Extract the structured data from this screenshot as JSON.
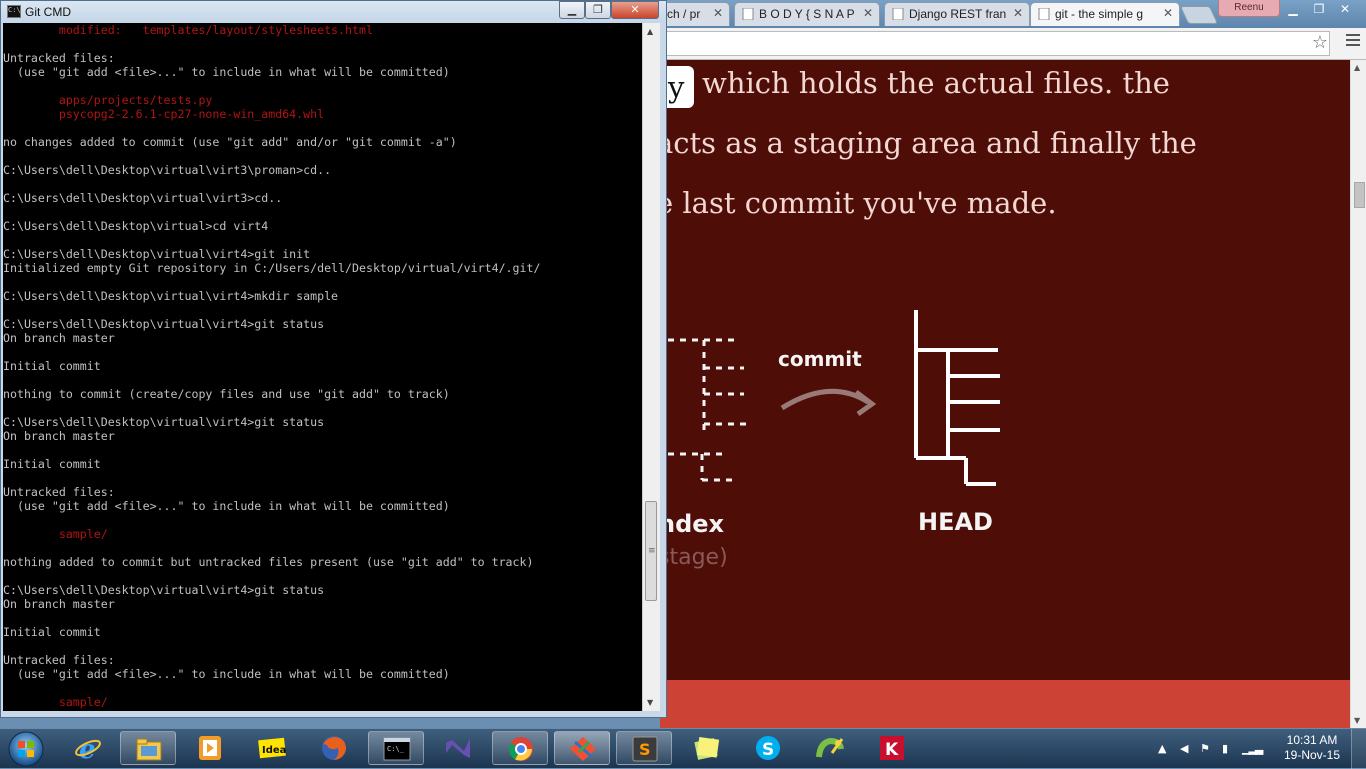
{
  "cmd": {
    "title": "Git CMD",
    "lines": [
      {
        "text": "        modified:   templates/layout/stylesheets.html",
        "color": "red"
      },
      {
        "text": "",
        "color": "gray"
      },
      {
        "text": "Untracked files:",
        "color": "gray"
      },
      {
        "text": "  (use \"git add <file>...\" to include in what will be committed)",
        "color": "gray"
      },
      {
        "text": "",
        "color": "gray"
      },
      {
        "text": "        apps/projects/tests.py",
        "color": "red"
      },
      {
        "text": "        psycopg2-2.6.1-cp27-none-win_amd64.whl",
        "color": "red"
      },
      {
        "text": "",
        "color": "gray"
      },
      {
        "text": "no changes added to commit (use \"git add\" and/or \"git commit -a\")",
        "color": "gray"
      },
      {
        "text": "",
        "color": "gray"
      },
      {
        "text": "C:\\Users\\dell\\Desktop\\virtual\\virt3\\proman>cd..",
        "color": "gray"
      },
      {
        "text": "",
        "color": "gray"
      },
      {
        "text": "C:\\Users\\dell\\Desktop\\virtual\\virt3>cd..",
        "color": "gray"
      },
      {
        "text": "",
        "color": "gray"
      },
      {
        "text": "C:\\Users\\dell\\Desktop\\virtual>cd virt4",
        "color": "gray"
      },
      {
        "text": "",
        "color": "gray"
      },
      {
        "text": "C:\\Users\\dell\\Desktop\\virtual\\virt4>git init",
        "color": "gray"
      },
      {
        "text": "Initialized empty Git repository in C:/Users/dell/Desktop/virtual/virt4/.git/",
        "color": "gray"
      },
      {
        "text": "",
        "color": "gray"
      },
      {
        "text": "C:\\Users\\dell\\Desktop\\virtual\\virt4>mkdir sample",
        "color": "gray"
      },
      {
        "text": "",
        "color": "gray"
      },
      {
        "text": "C:\\Users\\dell\\Desktop\\virtual\\virt4>git status",
        "color": "gray"
      },
      {
        "text": "On branch master",
        "color": "gray"
      },
      {
        "text": "",
        "color": "gray"
      },
      {
        "text": "Initial commit",
        "color": "gray"
      },
      {
        "text": "",
        "color": "gray"
      },
      {
        "text": "nothing to commit (create/copy files and use \"git add\" to track)",
        "color": "gray"
      },
      {
        "text": "",
        "color": "gray"
      },
      {
        "text": "C:\\Users\\dell\\Desktop\\virtual\\virt4>git status",
        "color": "gray"
      },
      {
        "text": "On branch master",
        "color": "gray"
      },
      {
        "text": "",
        "color": "gray"
      },
      {
        "text": "Initial commit",
        "color": "gray"
      },
      {
        "text": "",
        "color": "gray"
      },
      {
        "text": "Untracked files:",
        "color": "gray"
      },
      {
        "text": "  (use \"git add <file>...\" to include in what will be committed)",
        "color": "gray"
      },
      {
        "text": "",
        "color": "gray"
      },
      {
        "text": "        sample/",
        "color": "red"
      },
      {
        "text": "",
        "color": "gray"
      },
      {
        "text": "nothing added to commit but untracked files present (use \"git add\" to track)",
        "color": "gray"
      },
      {
        "text": "",
        "color": "gray"
      },
      {
        "text": "C:\\Users\\dell\\Desktop\\virtual\\virt4>git status",
        "color": "gray"
      },
      {
        "text": "On branch master",
        "color": "gray"
      },
      {
        "text": "",
        "color": "gray"
      },
      {
        "text": "Initial commit",
        "color": "gray"
      },
      {
        "text": "",
        "color": "gray"
      },
      {
        "text": "Untracked files:",
        "color": "gray"
      },
      {
        "text": "  (use \"git add <file>...\" to include in what will be committed)",
        "color": "gray"
      },
      {
        "text": "",
        "color": "gray"
      },
      {
        "text": "        sample/",
        "color": "red"
      }
    ],
    "colors": {
      "gray": "#c0c0c0",
      "red": "#b01414"
    }
  },
  "browser": {
    "tabs": [
      {
        "label": "ch / pr",
        "icon": "page-icon"
      },
      {
        "label": "B O D Y { S N A P",
        "icon": "page-icon"
      },
      {
        "label": "Django REST fran",
        "icon": "page-icon"
      },
      {
        "label": "git - the simple g",
        "icon": "page-icon"
      }
    ],
    "profile": "Reenu",
    "content": {
      "code_chip": "y",
      "lines": [
        "which holds the actual files. the",
        "acts as a staging area and finally the",
        "e last commit you've made."
      ],
      "diagram": {
        "arrow_label": "commit",
        "left_label": "ndex",
        "left_sublabel": "stage)",
        "right_label": "HEAD"
      }
    },
    "colors": {
      "page_bg": "#4f0d07",
      "footer": "#cc4336",
      "text": "#f2d7d2"
    }
  },
  "taskbar": {
    "items": [
      {
        "icon": "internet-explorer-icon",
        "open": false
      },
      {
        "icon": "file-explorer-icon",
        "open": true
      },
      {
        "icon": "media-player-icon",
        "open": false
      },
      {
        "icon": "idea-icon",
        "open": false,
        "label": "Idea"
      },
      {
        "icon": "firefox-icon",
        "open": false
      },
      {
        "icon": "command-prompt-icon",
        "open": true
      },
      {
        "icon": "visual-studio-icon",
        "open": false
      },
      {
        "icon": "chrome-icon",
        "open": true
      },
      {
        "icon": "git-gui-icon",
        "open": true,
        "active": true
      },
      {
        "icon": "sublime-text-icon",
        "open": true,
        "label": "S"
      },
      {
        "icon": "sticky-notes-icon",
        "open": false
      },
      {
        "icon": "skype-icon",
        "open": false
      },
      {
        "icon": "python-idle-icon",
        "open": false
      },
      {
        "icon": "kaspersky-icon",
        "open": false
      }
    ],
    "clock": {
      "time": "10:31 AM",
      "date": "19-Nov-15"
    }
  }
}
